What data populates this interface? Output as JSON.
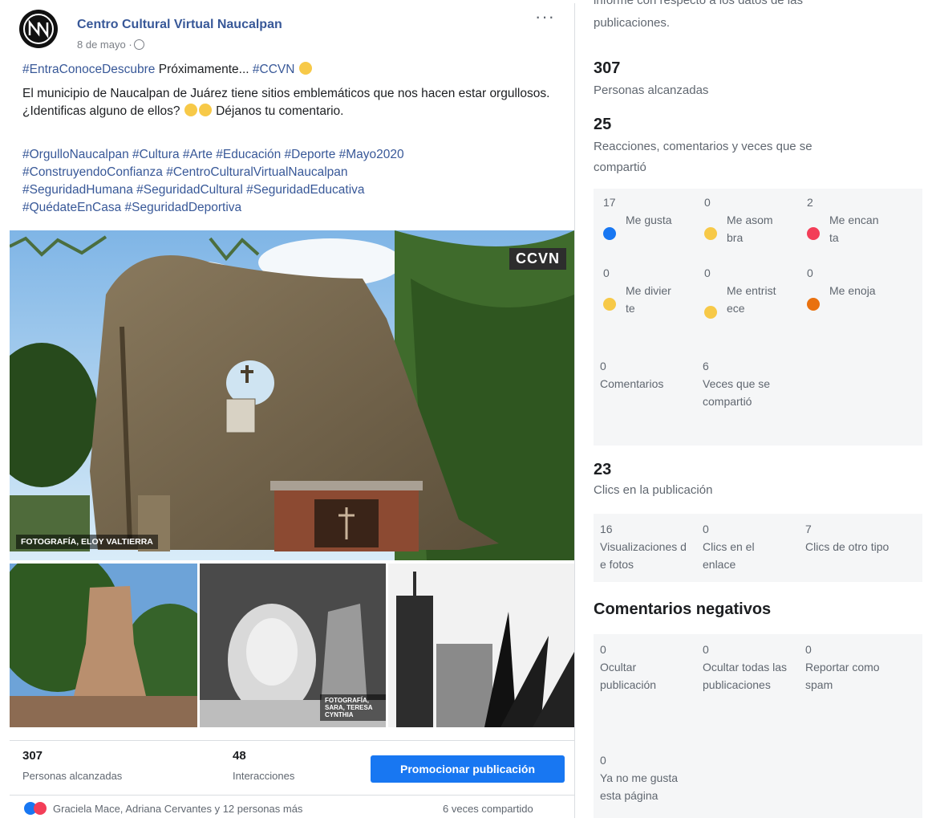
{
  "post": {
    "page_name": "Centro Cultural Virtual Naucalpan",
    "date": "8 de mayo ·",
    "more_label": "···",
    "line1_tag": "#EntraConoceDescubre",
    "line1_text": " Próximamente... ",
    "line1_tag2": "#CCVN",
    "body": "El municipio de Naucalpan de Juárez tiene sitios emblemáticos que nos hacen estar orgullosos. ¿Identificas alguno de ellos?",
    "body_end": "Déjanos tu comentario.",
    "hashtags": [
      "#OrgulloNaucalpan #Cultura #Arte #Educación #Deporte #Mayo2020",
      "#ConstruyendoConfianza #CentroCulturalVirtualNaucalpan",
      "#SeguridadHumana #SeguridadCultural #SeguridadEducativa",
      "#QuédateEnCasa #SeguridadDeportiva"
    ],
    "photo_brand": "CCVN",
    "photo_credit": "FOTOGRAFÍA, ELOY VALTIERRA",
    "photo_credit_2": "FOTOGRAFÍA, SARA, TERESA CYNTHIA",
    "reach_num": "307",
    "reach_label": "Personas alcanzadas",
    "interactions_num": "48",
    "interactions_label": "Interacciones",
    "promote_label": "Promocionar publicación",
    "reactors": "Graciela Mace, Adriana Cervantes y 12 personas más",
    "shares": "6 veces compartido"
  },
  "side": {
    "top_text_1": "informe con respecto a los datos de las",
    "top_text_2": "publicaciones.",
    "reach_num": "307",
    "reach_label": "Personas alcanzadas",
    "engage_num": "25",
    "engage_label_1": "Reacciones, comentarios y veces que se",
    "engage_label_2": "compartió",
    "reactions": [
      {
        "num": "17",
        "label": "Me gusta",
        "icon": "like-icon",
        "color": "#1877f2"
      },
      {
        "num": "0",
        "label": "Me asombra",
        "icon": "wow-icon",
        "color": "#f7c948"
      },
      {
        "num": "2",
        "label": "Me encanta",
        "icon": "love-icon",
        "color": "#f33e58"
      },
      {
        "num": "0",
        "label": "Me divierte",
        "icon": "haha-icon",
        "color": "#f7c948"
      },
      {
        "num": "0",
        "label": "Me entristece",
        "icon": "sad-icon",
        "color": "#f7c948"
      },
      {
        "num": "0",
        "label": "Me enoja",
        "icon": "angry-icon",
        "color": "#e9710f"
      }
    ],
    "comments_num": "0",
    "comments_label": "Comentarios",
    "shares_num": "6",
    "shares_label": "Veces que se compartió",
    "clicks_num": "23",
    "clicks_label": "Clics en la publicación",
    "clicks": [
      {
        "num": "16",
        "label": "Visualizaciones de fotos"
      },
      {
        "num": "0",
        "label": "Clics en el enlace"
      },
      {
        "num": "7",
        "label": "Clics de otro tipo"
      }
    ],
    "negative_title": "Comentarios negativos",
    "negative": [
      {
        "num": "0",
        "label": "Ocultar publicación"
      },
      {
        "num": "0",
        "label": "Ocultar todas las publicaciones"
      },
      {
        "num": "0",
        "label": "Reportar como spam"
      },
      {
        "num": "0",
        "label": "Ya no me gusta esta página"
      }
    ]
  }
}
